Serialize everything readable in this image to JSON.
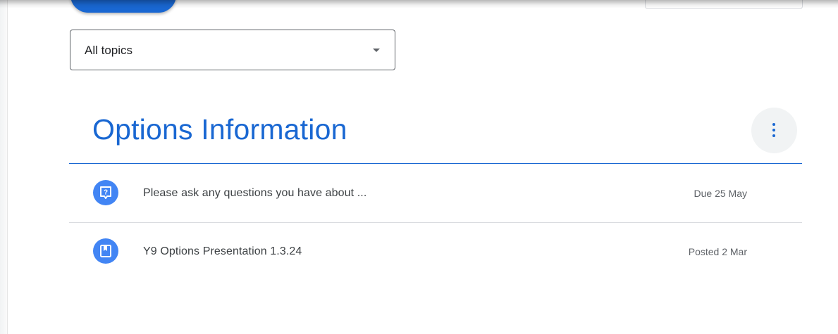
{
  "filter": {
    "selected": "All topics"
  },
  "topic": {
    "title": "Options Information",
    "items": [
      {
        "icon": "question-icon",
        "title": "Please ask any questions you have about ...",
        "meta": "Due 25 May"
      },
      {
        "icon": "material-icon",
        "title": "Y9 Options Presentation 1.3.24",
        "meta": "Posted 2 Mar"
      }
    ]
  },
  "colors": {
    "accent": "#1967d2",
    "icon_bg": "#4285f4",
    "divider": "#dadce0"
  }
}
